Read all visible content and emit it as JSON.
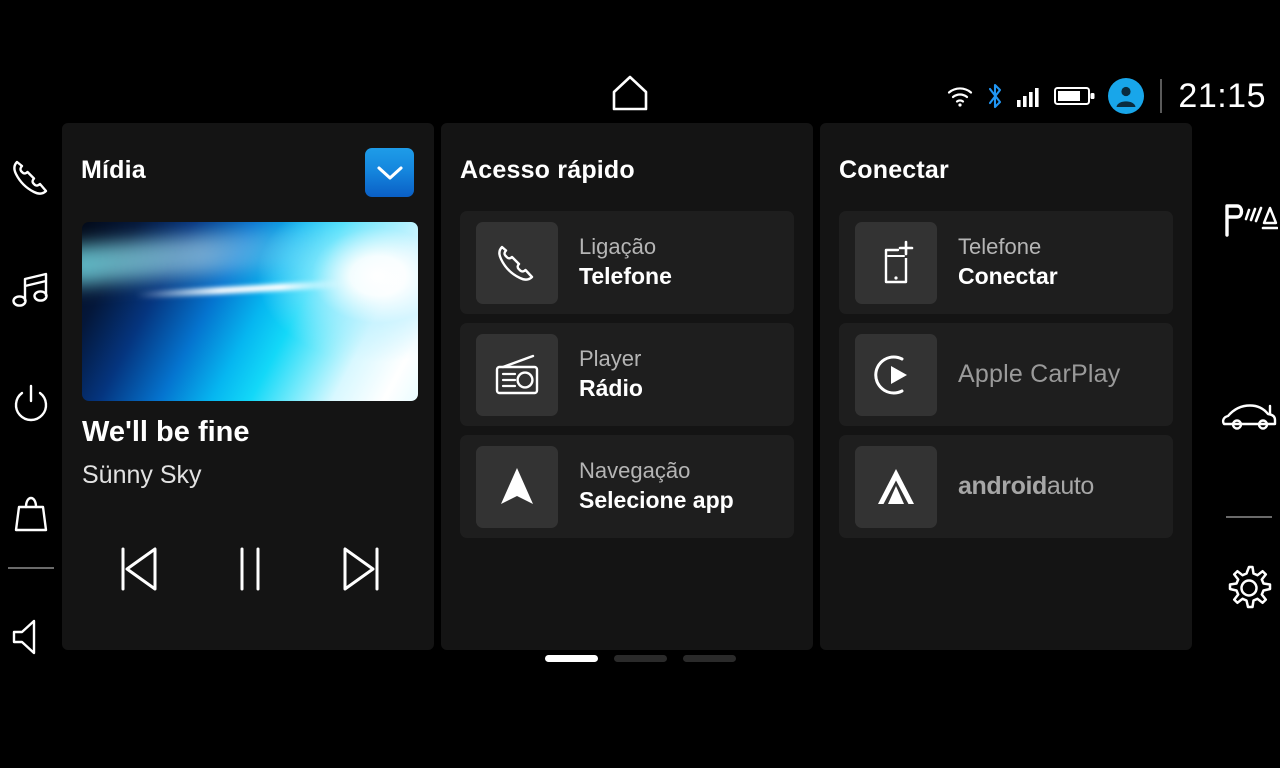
{
  "statusbar": {
    "home_icon": "home-icon",
    "icons": [
      "wifi-icon",
      "bluetooth-icon",
      "signal-icon",
      "battery-icon",
      "avatar-icon"
    ],
    "battery_level_pct": 70,
    "clock": "21:15",
    "avatar_color": "#18a6ea"
  },
  "sidebar_left": {
    "items": [
      {
        "name": "phone-icon",
        "label": "Telefone"
      },
      {
        "name": "music-icon",
        "label": "Música"
      },
      {
        "name": "power-icon",
        "label": "Liga/Desliga"
      },
      {
        "name": "bag-icon",
        "label": "Apps"
      },
      {
        "name": "volume-mute-icon",
        "label": "Volume"
      }
    ]
  },
  "sidebar_right": {
    "items": [
      {
        "name": "park-assist-icon",
        "label": "P"
      },
      {
        "name": "car-icon",
        "label": "Veículo"
      },
      {
        "name": "settings-gear-icon",
        "label": "Configurações"
      }
    ]
  },
  "media_card": {
    "title": "Mídia",
    "dropdown_icon": "chevron-down-icon",
    "album_art": "abstract-cyan-gradient",
    "track_title": "We'll be fine",
    "track_artist": "Sünny Sky",
    "controls": [
      {
        "name": "previous-track-button",
        "icon": "skip-previous-icon"
      },
      {
        "name": "play-pause-button",
        "icon": "pause-icon"
      },
      {
        "name": "next-track-button",
        "icon": "skip-next-icon"
      }
    ]
  },
  "quick_access_card": {
    "title": "Acesso rápido",
    "rows": [
      {
        "icon": "phone-handset-icon",
        "label": "Ligação",
        "value": "Telefone"
      },
      {
        "icon": "radio-icon",
        "label": "Player",
        "value": "Rádio"
      },
      {
        "icon": "navigation-arrow-icon",
        "label": "Navegação",
        "value": "Selecione app"
      }
    ]
  },
  "connect_card": {
    "title": "Conectar",
    "rows": [
      {
        "icon": "phone-add-icon",
        "label": "Telefone",
        "value": "Conectar",
        "brand": ""
      },
      {
        "icon": "apple-carplay-icon",
        "label": "",
        "value": "",
        "brand": "Apple CarPlay"
      },
      {
        "icon": "android-auto-icon",
        "label": "",
        "value": "",
        "brand_bold": "android",
        "brand_thin": "auto"
      }
    ]
  },
  "pager": {
    "total": 3,
    "active_index": 1
  },
  "colors": {
    "background": "#000000",
    "card": "#141414",
    "row": "#1e1e1e",
    "icon_tile": "#333333",
    "accent_blue": "#1587de",
    "muted_text": "#b5b5b5",
    "disabled_text": "#9a9a9a"
  }
}
